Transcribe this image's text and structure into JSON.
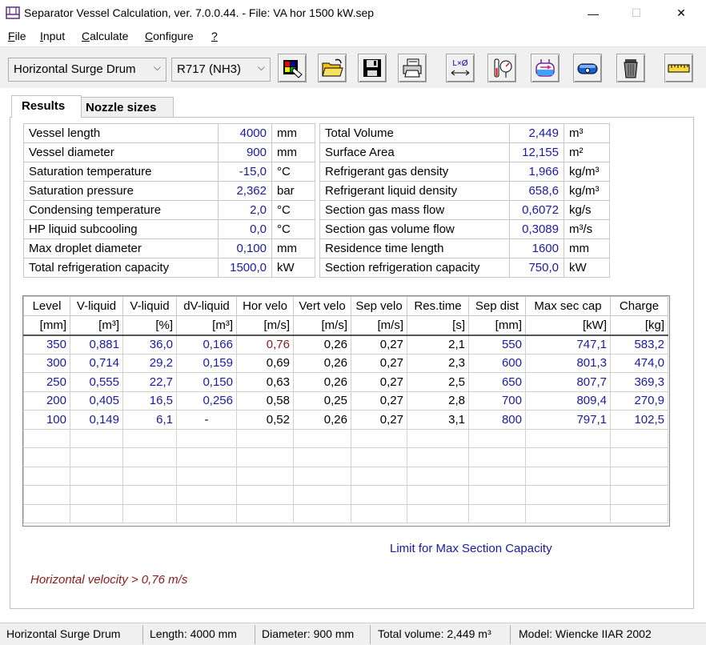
{
  "window": {
    "title": "Separator Vessel Calculation, ver. 7.0.0.44.  -  File: VA hor 1500 kW.sep",
    "controls": {
      "minimize": "—",
      "maximize": "☐",
      "close": "✕"
    }
  },
  "menu": {
    "file": {
      "u": "F",
      "rest": "ile"
    },
    "input": {
      "u": "I",
      "rest": "nput"
    },
    "calculate": {
      "u": "C",
      "rest": "alculate"
    },
    "configure": {
      "u": "C",
      "rest": "onfigure"
    },
    "help": {
      "u": "?",
      "rest": ""
    }
  },
  "toolbar": {
    "vessel_type": "Horizontal Surge Drum",
    "refrigerant": "R717 (NH3)",
    "dropdown_arrow": "⌵",
    "dimension_label": "L×Ø",
    "buttons": [
      "new-icon",
      "open-folder-icon",
      "save-disk-icon",
      "print-icon",
      "dimensions-icon",
      "gauge-icon",
      "vessel-level-icon",
      "tank-icon",
      "trash-icon",
      "ruler-icon"
    ]
  },
  "tabs": {
    "results": "Results",
    "nozzle_sizes": "Nozzle sizes"
  },
  "summary": {
    "left": [
      {
        "label": "Vessel length",
        "value": "4000",
        "unit": "mm"
      },
      {
        "label": "Vessel diameter",
        "value": "900",
        "unit": "mm"
      },
      {
        "label": "Saturation temperature",
        "value": "-15,0",
        "unit": "°C"
      },
      {
        "label": "Saturation pressure",
        "value": "2,362",
        "unit": "bar"
      },
      {
        "label": "Condensing temperature",
        "value": "2,0",
        "unit": "°C"
      },
      {
        "label": "HP liquid subcooling",
        "value": "0,0",
        "unit": "°C"
      },
      {
        "label": "Max droplet diameter",
        "value": "0,100",
        "unit": "mm"
      },
      {
        "label": "Total refrigeration capacity",
        "value": "1500,0",
        "unit": "kW"
      }
    ],
    "right": [
      {
        "label": "Total Volume",
        "value": "2,449",
        "unit": "m³"
      },
      {
        "label": "Surface Area",
        "value": "12,155",
        "unit": "m²"
      },
      {
        "label": "Refrigerant gas density",
        "value": "1,966",
        "unit": "kg/m³"
      },
      {
        "label": "Refrigerant liquid density",
        "value": "658,6",
        "unit": "kg/m³"
      },
      {
        "label": "Section gas mass flow",
        "value": "0,6072",
        "unit": "kg/s"
      },
      {
        "label": "Section gas volume flow",
        "value": "0,3089",
        "unit": "m³/s"
      },
      {
        "label": "Residence time length",
        "value": "1600",
        "unit": "mm"
      },
      {
        "label": "Section refrigeration capacity",
        "value": "750,0",
        "unit": "kW"
      }
    ]
  },
  "grid": {
    "headers": [
      "Level",
      "V-liquid",
      "V-liquid",
      "dV-liquid",
      "Hor velo",
      "Vert velo",
      "Sep velo",
      "Res.time",
      "Sep dist",
      "Max sec cap",
      "Charge"
    ],
    "units": [
      "[mm]",
      "[m³]",
      "[%]",
      "[m³]",
      "[m/s]",
      "[m/s]",
      "[m/s]",
      "[s]",
      "[mm]",
      "[kW]",
      "[kg]"
    ],
    "rows": [
      [
        "350",
        "0,881",
        "36,0",
        "0,166",
        "0,76",
        "0,26",
        "0,27",
        "2,1",
        "550",
        "747,1",
        "583,2"
      ],
      [
        "300",
        "0,714",
        "29,2",
        "0,159",
        "0,69",
        "0,26",
        "0,27",
        "2,3",
        "600",
        "801,3",
        "474,0"
      ],
      [
        "250",
        "0,555",
        "22,7",
        "0,150",
        "0,63",
        "0,26",
        "0,27",
        "2,5",
        "650",
        "807,7",
        "369,3"
      ],
      [
        "200",
        "0,405",
        "16,5",
        "0,256",
        "0,58",
        "0,25",
        "0,27",
        "2,8",
        "700",
        "809,4",
        "270,9"
      ],
      [
        "100",
        "0,149",
        "6,1",
        "-",
        "0,52",
        "0,26",
        "0,27",
        "3,1",
        "800",
        "797,1",
        "102,5"
      ]
    ],
    "empty_rows": 5
  },
  "limit_label": "Limit for Max Section Capacity",
  "warning": "Horizontal velocity > 0,76 m/s",
  "status": {
    "vessel_type": "Horizontal Surge Drum",
    "length": "Length: 4000 mm",
    "diameter": "Diameter: 900 mm",
    "total_volume": "Total volume: 2,449 m³",
    "model": "Model: Wiencke IIAR 2002"
  },
  "colors": {
    "value_blue": "#1a1aa0",
    "warning_red": "#8b1a1a",
    "panel_gray": "#f0f0f0"
  }
}
